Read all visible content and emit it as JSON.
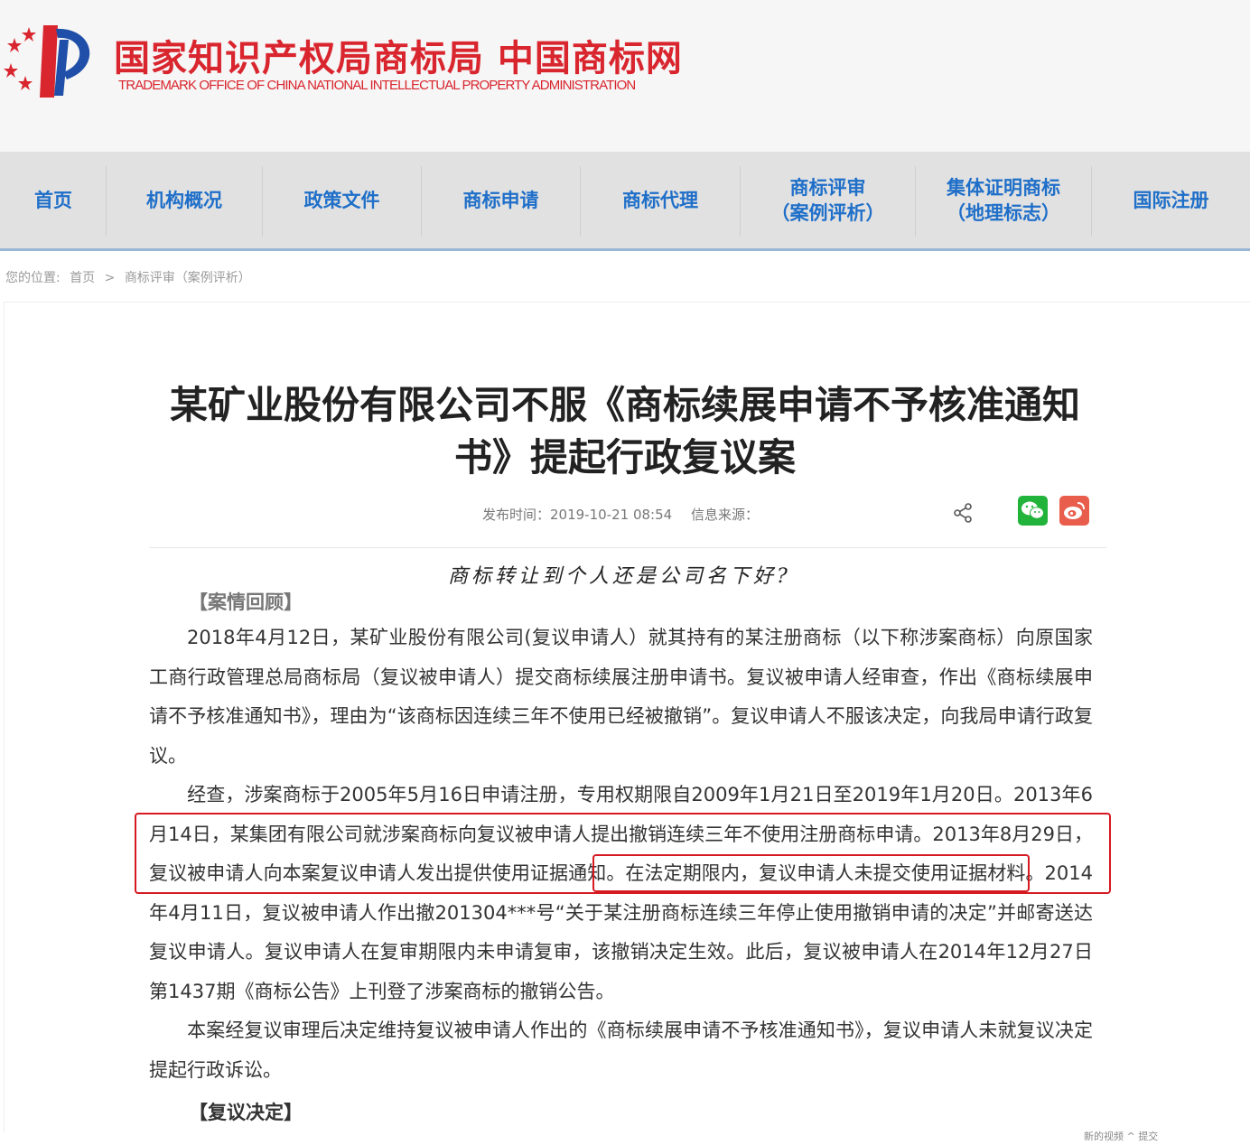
{
  "header": {
    "title": "国家知识产权局商标局 中国商标网",
    "subtitle": "TRADEMARK OFFICE OF CHINA NATIONAL INTELLECTUAL PROPERTY ADMINISTRATION",
    "brand_color": "#d9252e"
  },
  "nav": {
    "items": [
      {
        "label": "首页"
      },
      {
        "label": "机构概况"
      },
      {
        "label": "政策文件"
      },
      {
        "label": "商标申请"
      },
      {
        "label": "商标代理"
      },
      {
        "label": "商标评审",
        "sub": "（案例评析）"
      },
      {
        "label": "集体证明商标",
        "sub": "（地理标志）"
      },
      {
        "label": "国际注册"
      }
    ],
    "color": "#1f6fc9"
  },
  "breadcrumb": {
    "prefix": "您的位置:",
    "home": "首页",
    "separator": ">",
    "current": "商标评审（案例评析）"
  },
  "article": {
    "title": "某矿业股份有限公司不服《商标续展申请不予核准通知书》提起行政复议案",
    "publish_label": "发布时间：2019-10-21 08:54",
    "source_label": "信息来源：",
    "handwritten_note": "商标转让到个人还是公司名下好?",
    "section1": "【案情回顾】",
    "para1": "2018年4月12日，某矿业股份有限公司(复议申请人）就其持有的某注册商标（以下称涉案商标）向原国家工商行政管理总局商标局（复议被申请人）提交商标续展注册申请书。复议被申请人经审查，作出《商标续展申请不予核准通知书》，理由为“该商标因连续三年不使用已经被撤销”。复议申请人不服该决定，向我局申请行政复议。",
    "para2": "经查，涉案商标于2005年5月16日申请注册，专用权期限自2009年1月21日至2019年1月20日。2013年6月14日，某集团有限公司就涉案商标向复议被申请人提出撤销连续三年不使用注册商标申请。2013年8月29日，复议被申请人向本案复议申请人发出提供使用证据通知。在法定期限内，复议申请人未提交使用证据材料。2014年4月11日，复议被申请人作出撤201304***号“关于某注册商标连续三年停止使用撤销申请的决定”并邮寄送达复议申请人。复议申请人在复审期限内未申请复审，该撤销决定生效。此后，复议被申请人在2014年12月27日第1437期《商标公告》上刊登了涉案商标的撤销公告。",
    "para3": "本案经复议审理后决定维持复议被申请人作出的《商标续展申请不予核准通知书》，复议申请人未就复议决定提起行政诉讼。",
    "section2": "【复议决定】"
  },
  "share": {
    "icons": [
      "share-icon",
      "wechat-icon",
      "weibo-icon"
    ]
  },
  "bottom": {
    "text": "新的视频  ^  提交"
  }
}
